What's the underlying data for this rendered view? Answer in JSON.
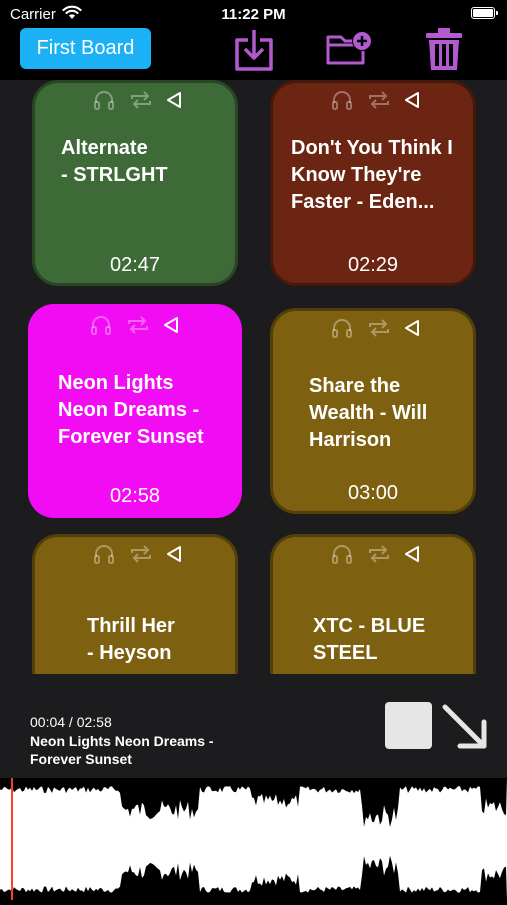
{
  "status": {
    "carrier": "Carrier",
    "time": "11:22 PM"
  },
  "toolbar": {
    "board_label": "First Board"
  },
  "colors": {
    "accent": "#1bb1f4",
    "icon_purple": "#b45ad0"
  },
  "cards": [
    {
      "title": "Alternate\n - STRLGHT",
      "duration": "02:47",
      "color": "#3e6a38"
    },
    {
      "title": "Don't You Think I Know They're Faster - Eden...",
      "duration": "02:29",
      "color": "#6b2512"
    },
    {
      "title": "Neon Lights Neon Dreams - Forever Sunset",
      "duration": "02:58",
      "color": "#f20cf4"
    },
    {
      "title": "Share the Wealth - Will Harrison",
      "duration": "03:00",
      "color": "#7e6110"
    },
    {
      "title": "Thrill Her\n - Heyson",
      "duration": "",
      "color": "#7e6110"
    },
    {
      "title": "XTC - BLUE STEEL",
      "duration": "",
      "color": "#7e6110"
    }
  ],
  "player": {
    "progress": "00:04 / 02:58",
    "now_playing": "Neon Lights Neon Dreams - Forever Sunset",
    "position_fraction": 0.0225
  }
}
